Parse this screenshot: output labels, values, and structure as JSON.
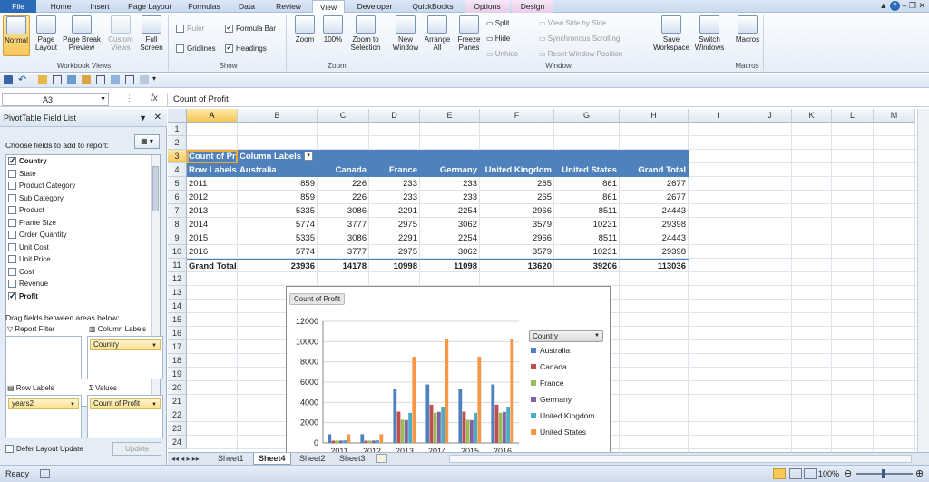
{
  "tabs": [
    "File",
    "Home",
    "Insert",
    "Page Layout",
    "Formulas",
    "Data",
    "Review",
    "View",
    "Developer",
    "QuickBooks",
    "Options",
    "Design"
  ],
  "ribbon": {
    "workbook_views": {
      "label": "Workbook Views",
      "normal": "Normal",
      "page_layout": "Page Layout",
      "page_break": "Page Break Preview",
      "custom": "Custom Views",
      "full": "Full Screen"
    },
    "show": {
      "label": "Show",
      "ruler": "Ruler",
      "formula_bar": "Formula Bar",
      "gridlines": "Gridlines",
      "headings": "Headings"
    },
    "zoom": {
      "label": "Zoom",
      "zoom": "Zoom",
      "hundred": "100%",
      "to_selection": "Zoom to Selection"
    },
    "window": {
      "label": "Window",
      "new": "New Window",
      "arrange": "Arrange All",
      "freeze": "Freeze Panes",
      "split": "Split",
      "hide": "Hide",
      "unhide": "Unhide",
      "side": "View Side by Side",
      "sync": "Synchronous Scrolling",
      "reset": "Reset Window Position",
      "save_ws": "Save Workspace",
      "switch": "Switch Windows"
    },
    "macros": {
      "label": "Macros",
      "macros": "Macros"
    }
  },
  "formula_bar": {
    "cell": "A3",
    "fx": "fx",
    "content": "Count of Profit"
  },
  "pivot_pane": {
    "title": "PivotTable Field List",
    "choose": "Choose fields to add to report:",
    "fields": [
      {
        "name": "Country",
        "checked": true,
        "bold": true
      },
      {
        "name": "State",
        "checked": false,
        "bold": false
      },
      {
        "name": "Product Category",
        "checked": false,
        "bold": false
      },
      {
        "name": "Sub Category",
        "checked": false,
        "bold": false
      },
      {
        "name": "Product",
        "checked": false,
        "bold": false
      },
      {
        "name": "Frame Size",
        "checked": false,
        "bold": false
      },
      {
        "name": "Order Quantity",
        "checked": false,
        "bold": false
      },
      {
        "name": "Unit Cost",
        "checked": false,
        "bold": false
      },
      {
        "name": "Unit Price",
        "checked": false,
        "bold": false
      },
      {
        "name": "Cost",
        "checked": false,
        "bold": false
      },
      {
        "name": "Revenue",
        "checked": false,
        "bold": false
      },
      {
        "name": "Profit",
        "checked": true,
        "bold": true
      }
    ],
    "drag": "Drag fields between areas below:",
    "report_filter": "Report Filter",
    "column_labels": "Column Labels",
    "column_chip": "Country",
    "row_labels": "Row Labels",
    "row_chip": "years2",
    "values": "Values",
    "values_chip": "Count of Profit",
    "defer": "Defer Layout Update",
    "update": "Update"
  },
  "grid": {
    "columns": [
      "A",
      "B",
      "C",
      "D",
      "E",
      "F",
      "G",
      "H",
      "I",
      "J",
      "K",
      "L",
      "M"
    ],
    "rows": [
      "1",
      "2",
      "3",
      "4",
      "5",
      "6",
      "7",
      "8",
      "9",
      "10",
      "11",
      "12",
      "13",
      "14",
      "15",
      "16",
      "17",
      "18",
      "19",
      "20",
      "21",
      "22",
      "23",
      "24"
    ]
  },
  "pivot": {
    "title": "Count of Profit",
    "col_labels": "Column Labels",
    "row_labels": "Row Labels",
    "headers": [
      "Australia",
      "Canada",
      "France",
      "Germany",
      "United Kingdom",
      "United States",
      "Grand Total"
    ],
    "rows": [
      {
        "label": "2011",
        "values": [
          "859",
          "226",
          "233",
          "233",
          "265",
          "861",
          "2677"
        ]
      },
      {
        "label": "2012",
        "values": [
          "859",
          "226",
          "233",
          "233",
          "265",
          "861",
          "2677"
        ]
      },
      {
        "label": "2013",
        "values": [
          "5335",
          "3086",
          "2291",
          "2254",
          "2966",
          "8511",
          "24443"
        ]
      },
      {
        "label": "2014",
        "values": [
          "5774",
          "3777",
          "2975",
          "3062",
          "3579",
          "10231",
          "29398"
        ]
      },
      {
        "label": "2015",
        "values": [
          "5335",
          "3086",
          "2291",
          "2254",
          "2966",
          "8511",
          "24443"
        ]
      },
      {
        "label": "2016",
        "values": [
          "5774",
          "3777",
          "2975",
          "3062",
          "3579",
          "10231",
          "29398"
        ]
      }
    ],
    "total": {
      "label": "Grand Total",
      "values": [
        "23936",
        "14178",
        "10998",
        "11098",
        "13620",
        "39206",
        "113036"
      ]
    }
  },
  "chart_data": {
    "type": "bar",
    "title": "Count of Profit",
    "categories": [
      "2011",
      "2012",
      "2013",
      "2014",
      "2015",
      "2016"
    ],
    "legend_title": "Country",
    "ylim": [
      0,
      12000
    ],
    "yticks": [
      "0",
      "2000",
      "4000",
      "6000",
      "8000",
      "10000",
      "12000"
    ],
    "series": [
      {
        "name": "Australia",
        "color": "#4f81bd",
        "values": [
          859,
          859,
          5335,
          5774,
          5335,
          5774
        ]
      },
      {
        "name": "Canada",
        "color": "#c0504d",
        "values": [
          226,
          226,
          3086,
          3777,
          3086,
          3777
        ]
      },
      {
        "name": "France",
        "color": "#9bbb59",
        "values": [
          233,
          233,
          2291,
          2975,
          2291,
          2975
        ]
      },
      {
        "name": "Germany",
        "color": "#8064a2",
        "values": [
          233,
          233,
          2254,
          3062,
          2254,
          3062
        ]
      },
      {
        "name": "United Kingdom",
        "color": "#4bacc6",
        "values": [
          265,
          265,
          2966,
          3579,
          2966,
          3579
        ]
      },
      {
        "name": "United States",
        "color": "#f79646",
        "values": [
          861,
          861,
          8511,
          10231,
          8511,
          10231
        ]
      }
    ]
  },
  "sheets": [
    "Sheet1",
    "Sheet4",
    "Sheet2",
    "Sheet3"
  ],
  "active_sheet": "Sheet4",
  "status": {
    "ready": "Ready",
    "zoom": "100%"
  }
}
